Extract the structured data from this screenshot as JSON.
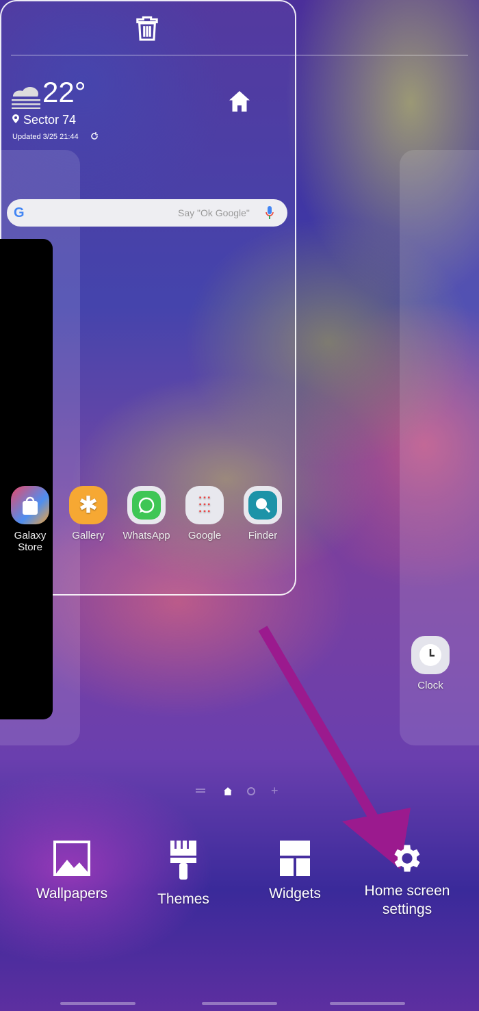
{
  "weather": {
    "temperature": "22°",
    "location": "Sector 74",
    "updated": "Updated 3/25 21:44"
  },
  "search": {
    "placeholder": "Say \"Ok Google\""
  },
  "apps": [
    {
      "label": "Galaxy Store"
    },
    {
      "label": "Gallery"
    },
    {
      "label": "WhatsApp"
    },
    {
      "label": "Google"
    },
    {
      "label": "Finder"
    }
  ],
  "next_page_apps": [
    {
      "label": "Clock"
    }
  ],
  "menu": {
    "wallpapers": "Wallpapers",
    "themes": "Themes",
    "widgets": "Widgets",
    "home_settings": "Home screen settings"
  },
  "colors": {
    "arrow": "#9b1a8e"
  }
}
